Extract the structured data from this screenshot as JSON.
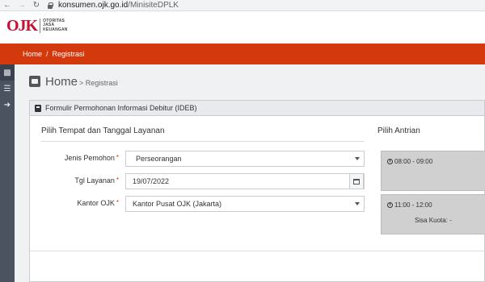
{
  "browser": {
    "url_host": "konsumen.ojk.go.id",
    "url_path": "/MinisiteDPLK"
  },
  "logo": {
    "mark": "OJK",
    "line1": "OTORITAS",
    "line2": "JASA",
    "line3": "KEUANGAN"
  },
  "breadcrumb": {
    "home": "Home",
    "separator": "/",
    "current": "Registrasi"
  },
  "page": {
    "title": "Home",
    "subtitle": "> Registrasi"
  },
  "panel": {
    "title": "Formulir Permohonan Informasi Debitur (IDEB)"
  },
  "left_section": {
    "title": "Pilih Tempat dan Tanggal Layanan",
    "fields": [
      {
        "label": "Jenis Pemohon",
        "required": "*",
        "value": "Perseorangan"
      },
      {
        "label": "Tgl Layanan",
        "required": "*",
        "value": "19/07/2022"
      },
      {
        "label": "Kantor OJK",
        "required": "*",
        "value": "Kantor Pusat OJK (Jakarta)"
      }
    ]
  },
  "right_section": {
    "title": "Pilih Antrian",
    "slots": [
      {
        "time": "08:00 - 09:00",
        "quota": ""
      },
      {
        "time": "11:00 - 12:00",
        "quota": "Sisa Kuota: -"
      }
    ]
  },
  "colors": {
    "brand_red": "#d4380d",
    "sidebar": "#4b5361",
    "slot_gray": "#d0d0d0"
  }
}
